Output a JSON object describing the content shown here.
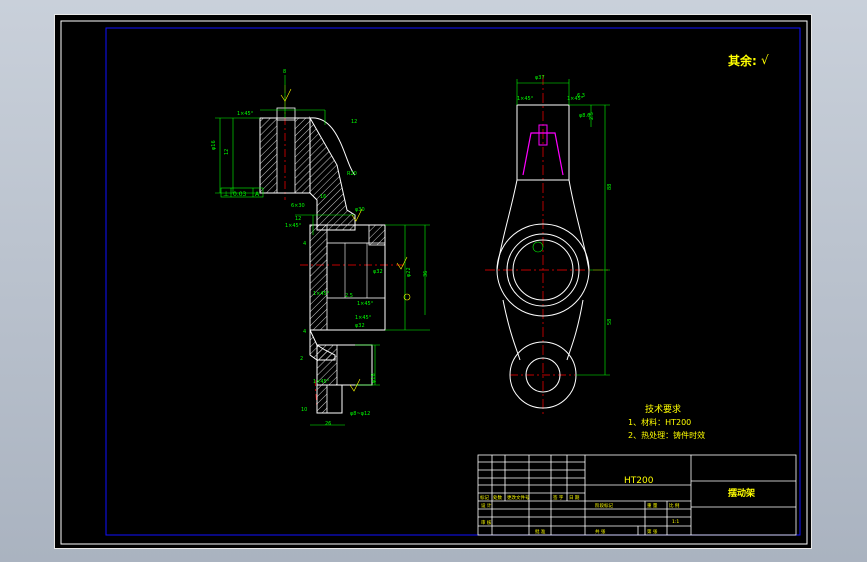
{
  "drawing": {
    "roughness_note": "其余:",
    "roughness_symbol": "√",
    "tech_requirements": {
      "title": "技术要求",
      "items": [
        "1、材料：HT200",
        "2、热处理：铸件时效"
      ]
    },
    "datum_callout": {
      "symbol": "⊥",
      "value": "0.03",
      "datum": "A"
    },
    "title_block": {
      "material": "HT200",
      "part_name": "摆动架",
      "scale": "1:1",
      "row_labels": [
        "标记",
        "处数",
        "更改文件号",
        "签 字",
        "日 期"
      ],
      "design_label": "设 计",
      "check_label": "审 核",
      "approve_label": "批 准",
      "stage_label": "阶段标记",
      "weight_label": "重 量",
      "scale_label": "比 例",
      "sheet_total": "共  张",
      "sheet_no": "第  张"
    },
    "colors": {
      "frame": "#ffffff",
      "inner_border": "#1010ff",
      "outline": "#ffffff",
      "dimension": "#00ff00",
      "centerline": "#ff0000",
      "annotation": "#ffff00",
      "hidden": "#ff00ff"
    }
  }
}
